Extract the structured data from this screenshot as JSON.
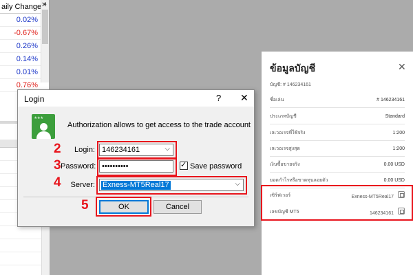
{
  "market_watch": {
    "header": "aily Change",
    "rows": [
      "0.02%",
      "-0.67%",
      "0.26%",
      "0.14%",
      "0.01%",
      "0.76%"
    ]
  },
  "login_dialog": {
    "title": "Login",
    "help": "?",
    "close": "✕",
    "message": "Authorization allows to get access to the trade account",
    "login_label": "Login:",
    "login_value": "146234161",
    "password_label": "Password:",
    "password_value": "••••••••••",
    "save_password_label": "Save password",
    "server_label": "Server:",
    "server_value": "Exness-MT5Real17",
    "ok_label": "OK",
    "cancel_label": "Cancel",
    "steps": [
      "2",
      "3",
      "4",
      "5"
    ]
  },
  "account_panel": {
    "title": "ข้อมูลบัญชี",
    "close": "✕",
    "account_id_line": "บัญชี: # 146234161",
    "rows": [
      {
        "label": "ชื่อเล่น",
        "value": "# 146234161"
      },
      {
        "label": "ประเภทบัญชี",
        "value": "Standard"
      },
      {
        "label": "เลเวอเรจที่ใช้จริง",
        "value": "1:200"
      },
      {
        "label": "เลเวอเรจสูงสุด",
        "value": "1:200"
      },
      {
        "label": "เงินซื้อขายจริง",
        "value": "0.00 USD"
      },
      {
        "label": "ยอดกำไรหรือขาดทุนลอยตัว",
        "value": "0.00 USD"
      }
    ],
    "server_label": "เซิร์ฟเวอร์",
    "server_value": "Exness-MT5Real17",
    "mt5_label": "เลขบัญชี MT5",
    "mt5_value": "146234161"
  },
  "colors": {
    "accent_red": "#e8141c",
    "select_blue": "#0078d7",
    "positive": "#1a35c8",
    "negative": "#e0201a"
  }
}
